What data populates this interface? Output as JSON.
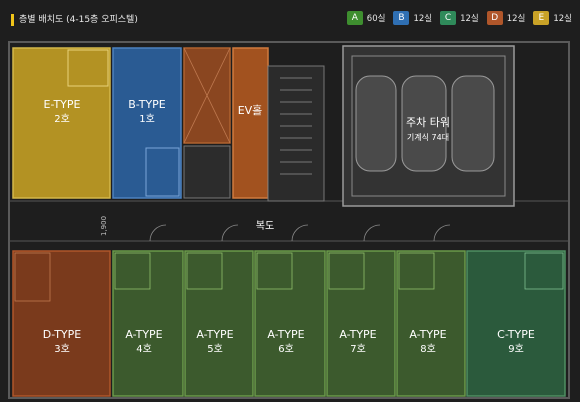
{
  "header": {
    "title": "층별 배치도 (4-15층 오피스텔)"
  },
  "legend": [
    {
      "letter": "A",
      "count": "60실",
      "color": "#3e8e2f"
    },
    {
      "letter": "B",
      "count": "12실",
      "color": "#2f6fb3"
    },
    {
      "letter": "C",
      "count": "12실",
      "color": "#2f8a5a"
    },
    {
      "letter": "D",
      "count": "12실",
      "color": "#b0562a"
    },
    {
      "letter": "E",
      "count": "12실",
      "color": "#c9a227"
    }
  ],
  "units": {
    "e_type": {
      "type": "E-TYPE",
      "number": "2호",
      "color": "#b39223"
    },
    "b_type": {
      "type": "B-TYPE",
      "number": "1호",
      "color": "#2a5b93"
    },
    "ev": {
      "label": "EV홀",
      "color": "#a2521f"
    },
    "d_type": {
      "type": "D-TYPE",
      "number": "3호",
      "color": "#7a3a1c"
    },
    "a4": {
      "type": "A-TYPE",
      "number": "4호",
      "color": "#3c5a2d"
    },
    "a5": {
      "type": "A-TYPE",
      "number": "5호",
      "color": "#3c5a2d"
    },
    "a6": {
      "type": "A-TYPE",
      "number": "6호",
      "color": "#3c5a2d"
    },
    "a7": {
      "type": "A-TYPE",
      "number": "7호",
      "color": "#3c5a2d"
    },
    "a8": {
      "type": "A-TYPE",
      "number": "8호",
      "color": "#3c5a2d"
    },
    "c_type": {
      "type": "C-TYPE",
      "number": "9호",
      "color": "#2b5a3c"
    }
  },
  "parking": {
    "title": "주차 타워",
    "subtitle": "기계식 74대"
  },
  "corridor": {
    "label": "복도",
    "dimension": "1,900"
  }
}
